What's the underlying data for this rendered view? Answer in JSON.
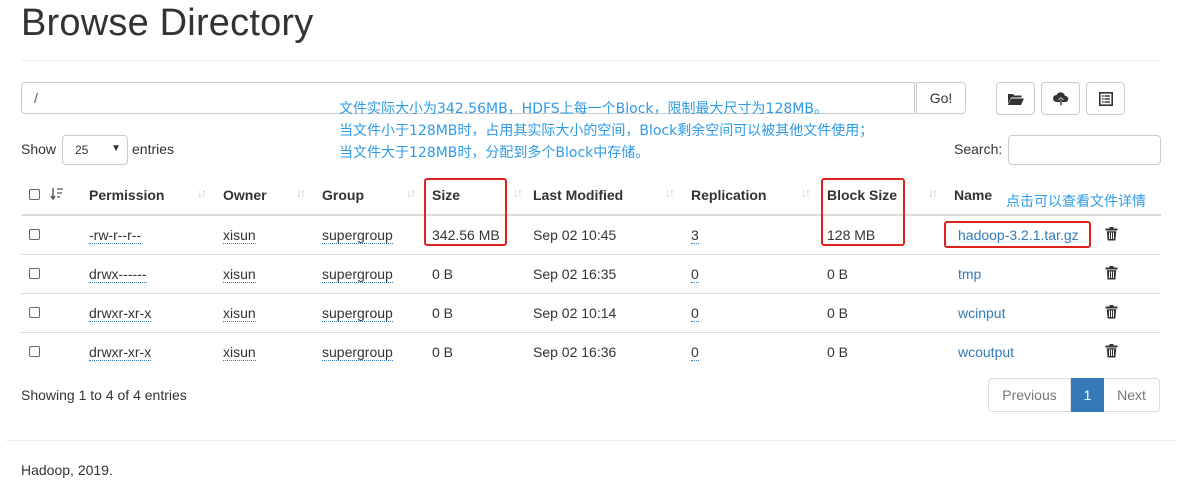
{
  "page": {
    "title": "Browse Directory"
  },
  "path_bar": {
    "value": "/",
    "go_label": "Go!"
  },
  "toolbar": {
    "folder_icon": "folder-open-icon",
    "upload_icon": "cloud-upload-icon",
    "list_icon": "list-alt-icon"
  },
  "annotation": {
    "line1": "文件实际大小为342.56MB，HDFS上每一个Block，限制最大尺寸为128MB。",
    "line2": "当文件小于128MB时，占用其实际大小的空间，Block剩余空间可以被其他文件使用；",
    "line3": "当文件大于128MB时，分配到多个Block中存储。",
    "name_hint": "点击可以查看文件详情"
  },
  "controls": {
    "show_label": "Show",
    "page_size": "25",
    "entries_label": "entries",
    "search_label": "Search:"
  },
  "table": {
    "headers": [
      "Permission",
      "Owner",
      "Group",
      "Size",
      "Last Modified",
      "Replication",
      "Block Size",
      "Name"
    ],
    "rows": [
      {
        "permission": "-rw-r--r--",
        "owner": "xisun",
        "group": "supergroup",
        "size": "342.56 MB",
        "modified": "Sep 02 10:45",
        "replication": "3",
        "block_size": "128 MB",
        "name": "hadoop-3.2.1.tar.gz"
      },
      {
        "permission": "drwx------",
        "owner": "xisun",
        "group": "supergroup",
        "size": "0 B",
        "modified": "Sep 02 16:35",
        "replication": "0",
        "block_size": "0 B",
        "name": "tmp"
      },
      {
        "permission": "drwxr-xr-x",
        "owner": "xisun",
        "group": "supergroup",
        "size": "0 B",
        "modified": "Sep 02 10:14",
        "replication": "0",
        "block_size": "0 B",
        "name": "wcinput"
      },
      {
        "permission": "drwxr-xr-x",
        "owner": "xisun",
        "group": "supergroup",
        "size": "0 B",
        "modified": "Sep 02 16:36",
        "replication": "0",
        "block_size": "0 B",
        "name": "wcoutput"
      }
    ]
  },
  "footer_info": {
    "showing": "Showing 1 to 4 of 4 entries",
    "prev": "Previous",
    "page": "1",
    "next": "Next",
    "copyright": "Hadoop, 2019."
  },
  "colors": {
    "link": "#337ab7",
    "annotation": "#2e9be6",
    "highlight_box": "#e0221e"
  }
}
